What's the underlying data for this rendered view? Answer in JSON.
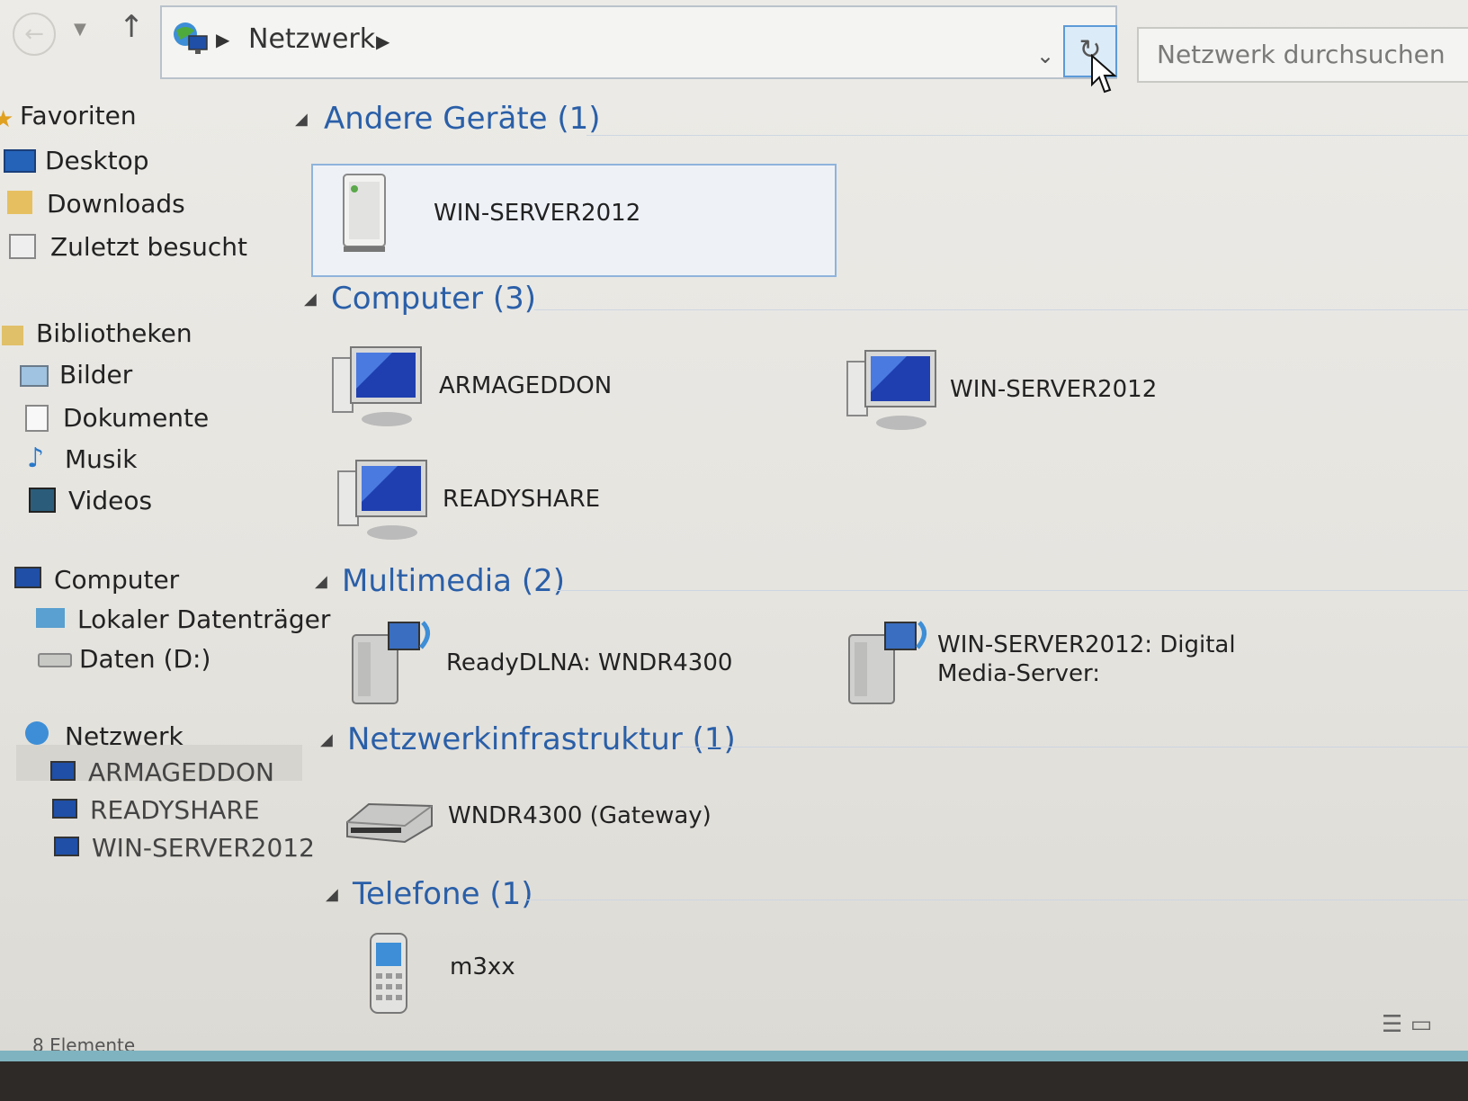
{
  "address_bar": {
    "breadcrumb": "Netzwerk",
    "search_placeholder": "Netzwerk durchsuchen"
  },
  "nav_pane": {
    "favorites_header": "Favoriten",
    "favorites": [
      "Desktop",
      "Downloads",
      "Zuletzt besucht"
    ],
    "libraries_header": "Bibliotheken",
    "libraries": [
      "Bilder",
      "Dokumente",
      "Musik",
      "Videos"
    ],
    "computer_header": "Computer",
    "drives": [
      "Lokaler Datenträger",
      "Daten (D:)"
    ],
    "network_header": "Netzwerk",
    "network_items": [
      "ARMAGEDDON",
      "READYSHARE",
      "WIN-SERVER2012"
    ]
  },
  "groups": {
    "other_devices": {
      "title": "Andere Geräte (1)",
      "items": [
        "WIN-SERVER2012"
      ]
    },
    "computers": {
      "title": "Computer (3)",
      "items": [
        "ARMAGEDDON",
        "WIN-SERVER2012",
        "READYSHARE"
      ]
    },
    "multimedia": {
      "title": "Multimedia (2)",
      "items": [
        "ReadyDLNA: WNDR4300",
        "WIN-SERVER2012: Digital",
        "Media-Server:"
      ]
    },
    "infrastructure": {
      "title": "Netzwerkinfrastruktur (1)",
      "items": [
        "WNDR4300 (Gateway)"
      ]
    },
    "phones": {
      "title": "Telefone (1)",
      "items": [
        "m3xx"
      ]
    }
  },
  "status_bar": {
    "count": "8 Elemente"
  },
  "colors": {
    "group_heading": "#2a5fa8",
    "selection_border": "#8fb3dc",
    "refresh_border": "#5c9ad8"
  },
  "icons": {
    "computer": "monitor-icon",
    "server": "server-tower-icon",
    "media": "media-server-icon",
    "router": "router-icon",
    "phone": "phone-icon"
  }
}
